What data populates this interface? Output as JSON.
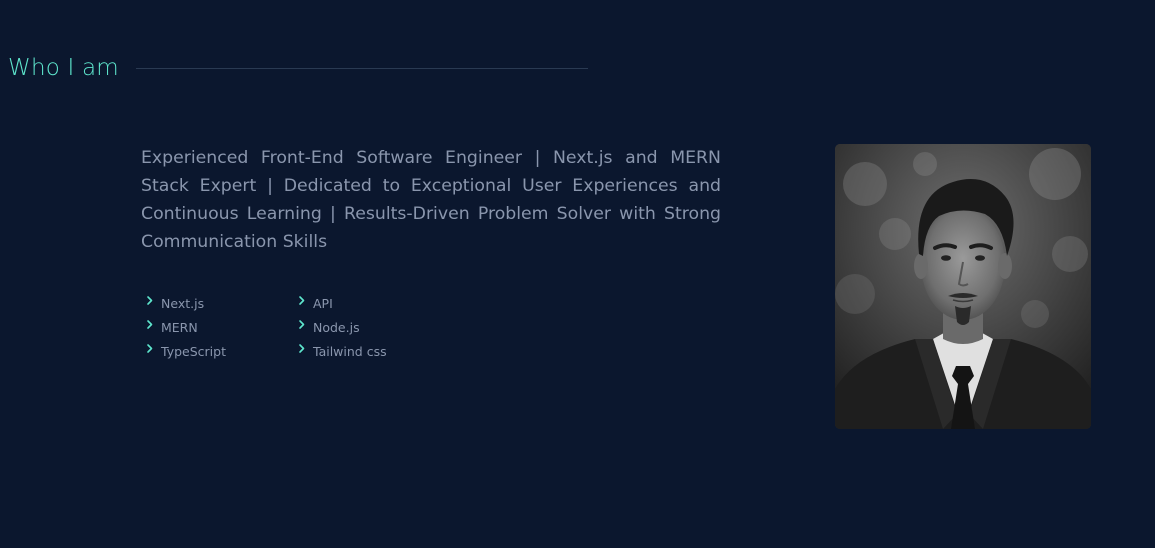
{
  "section": {
    "title": "Who I am"
  },
  "bio": {
    "text": "Experienced Front-End Software Engineer | Next.js and MERN Stack Expert | Dedicated to Exceptional User Experiences and Continuous Learning | Results-Driven Problem Solver with Strong Communication Skills"
  },
  "skills": [
    {
      "label": "Next.js"
    },
    {
      "label": "API"
    },
    {
      "label": "MERN"
    },
    {
      "label": "Node.js"
    },
    {
      "label": "TypeScript"
    },
    {
      "label": "Tailwind css"
    }
  ],
  "icons": {
    "skill_bullet": "chevron-right-icon"
  },
  "colors": {
    "background": "#0b172e",
    "accent": "#5ee6cd",
    "text": "#8a96ad",
    "divider": "#2a3a52"
  },
  "photo": {
    "style": "grayscale",
    "subject": "portrait"
  }
}
